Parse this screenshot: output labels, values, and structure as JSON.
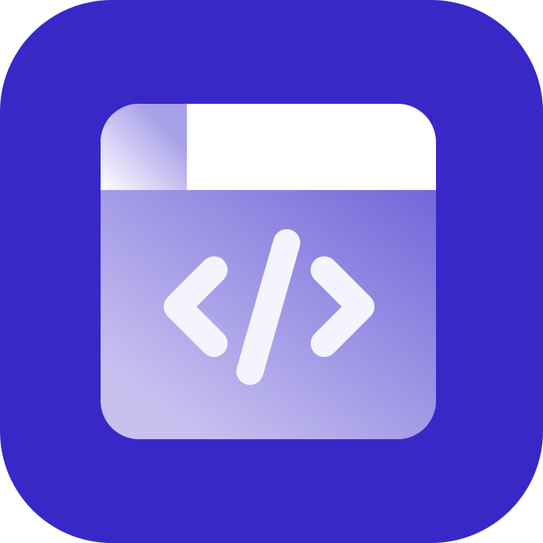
{
  "icon": {
    "name": "code-window-icon",
    "colors": {
      "background": "#3828C8",
      "title_bar": "#FFFFFF",
      "corner_tab_light": "#FFFFFF",
      "corner_tab_tint": "#A8A0E8",
      "panel_top_right": "#7366D9",
      "panel_bottom_left": "#C7C1F0",
      "code_glyph": "#F5F4FC"
    }
  }
}
